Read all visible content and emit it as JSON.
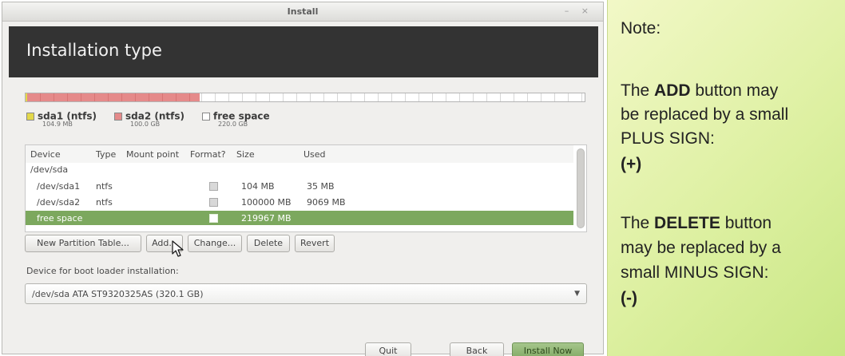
{
  "window": {
    "title": "Install",
    "controls": "– ×",
    "header": "Installation type"
  },
  "legend": [
    {
      "name": "sda1 (ntfs)",
      "size": "104.9 MB",
      "color": "#e3d84a"
    },
    {
      "name": "sda2 (ntfs)",
      "size": "100.0 GB",
      "color": "#e58a8a"
    },
    {
      "name": "free space",
      "size": "220.0 GB",
      "color": "#ffffff"
    }
  ],
  "table": {
    "columns": [
      "Device",
      "Type",
      "Mount point",
      "Format?",
      "Size",
      "Used"
    ],
    "disk": "/dev/sda",
    "rows": [
      {
        "device": "/dev/sda1",
        "type": "ntfs",
        "mount": "",
        "format": false,
        "size": "104 MB",
        "used": "35 MB"
      },
      {
        "device": "/dev/sda2",
        "type": "ntfs",
        "mount": "",
        "format": false,
        "size": "100000 MB",
        "used": "9069 MB"
      },
      {
        "device": "free space",
        "type": "",
        "mount": "",
        "format": false,
        "size": "219967 MB",
        "used": ""
      }
    ]
  },
  "buttons": {
    "new_table": "New Partition Table...",
    "add": "Add...",
    "change": "Change...",
    "delete": "Delete",
    "revert": "Revert",
    "quit": "Quit",
    "back": "Back",
    "install": "Install Now"
  },
  "boot": {
    "label": "Device for boot loader installation:",
    "value": "/dev/sda   ATA ST9320325AS (320.1 GB)"
  },
  "note": {
    "title": "Note:",
    "add_pre": "The ",
    "add_bold": "ADD",
    "add_post": " button may",
    "add_l2": "be replaced by a small",
    "add_l3": "PLUS SIGN:",
    "plus": "(+)",
    "del_pre": "The ",
    "del_bold": "DELETE",
    "del_post": " button",
    "del_l2": "may be replaced by a",
    "del_l3": "small MINUS SIGN:",
    "minus": "(-)"
  },
  "colors": {
    "header_bg": "#333333",
    "selected_row": "#7ca85e",
    "install_button": "#8fb573",
    "note_bg": "#ddf0a1"
  }
}
